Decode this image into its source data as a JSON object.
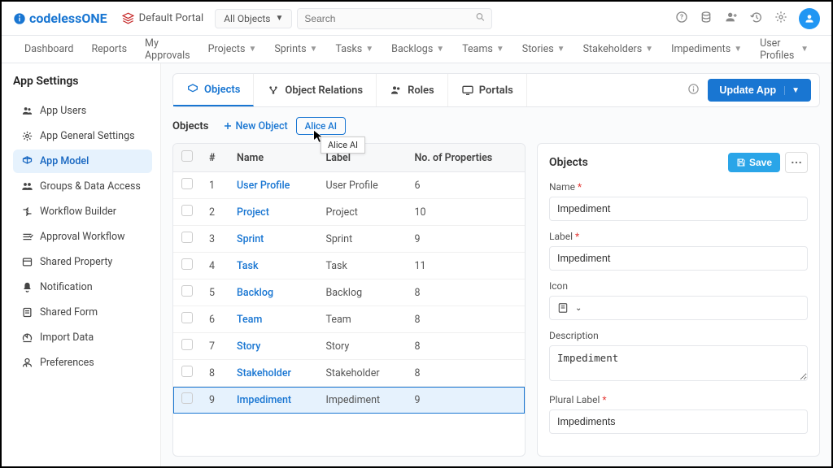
{
  "header": {
    "brand": "codelessONE",
    "portal": "Default Portal",
    "selector": "All Objects",
    "search_placeholder": "Search"
  },
  "nav": [
    "Dashboard",
    "Reports",
    "My Approvals",
    "Projects",
    "Sprints",
    "Tasks",
    "Backlogs",
    "Teams",
    "Stories",
    "Stakeholders",
    "Impediments",
    "User Profiles"
  ],
  "nav_dropdown": [
    false,
    false,
    false,
    true,
    true,
    true,
    true,
    true,
    true,
    true,
    true,
    true
  ],
  "sidebar": {
    "title": "App Settings",
    "items": [
      "App Users",
      "App General Settings",
      "App Model",
      "Groups & Data Access",
      "Workflow Builder",
      "Approval Workflow",
      "Shared Property",
      "Notification",
      "Shared Form",
      "Import Data",
      "Preferences"
    ],
    "active_index": 2
  },
  "tabs": {
    "items": [
      "Objects",
      "Object Relations",
      "Roles",
      "Portals"
    ],
    "active_index": 0,
    "update_label": "Update App"
  },
  "subrow": {
    "crumb": "Objects",
    "new_label": "New Object",
    "alice": "Alice AI",
    "tooltip": "Alice AI"
  },
  "table": {
    "headers": [
      "#",
      "Name",
      "Label",
      "No. of Properties"
    ],
    "rows": [
      {
        "n": "1",
        "name": "User Profile",
        "label": "User Profile",
        "props": "6"
      },
      {
        "n": "2",
        "name": "Project",
        "label": "Project",
        "props": "10"
      },
      {
        "n": "3",
        "name": "Sprint",
        "label": "Sprint",
        "props": "9"
      },
      {
        "n": "4",
        "name": "Task",
        "label": "Task",
        "props": "11"
      },
      {
        "n": "5",
        "name": "Backlog",
        "label": "Backlog",
        "props": "8"
      },
      {
        "n": "6",
        "name": "Team",
        "label": "Team",
        "props": "8"
      },
      {
        "n": "7",
        "name": "Story",
        "label": "Story",
        "props": "8"
      },
      {
        "n": "8",
        "name": "Stakeholder",
        "label": "Stakeholder",
        "props": "8"
      },
      {
        "n": "9",
        "name": "Impediment",
        "label": "Impediment",
        "props": "9"
      }
    ],
    "selected_index": 8
  },
  "detail": {
    "title": "Objects",
    "save_label": "Save",
    "fields": {
      "name_label": "Name",
      "name_value": "Impediment",
      "label_label": "Label",
      "label_value": "Impediment",
      "icon_label": "Icon",
      "desc_label": "Description",
      "desc_value": "Impediment",
      "plural_label": "Plural Label",
      "plural_value": "Impediments"
    }
  }
}
